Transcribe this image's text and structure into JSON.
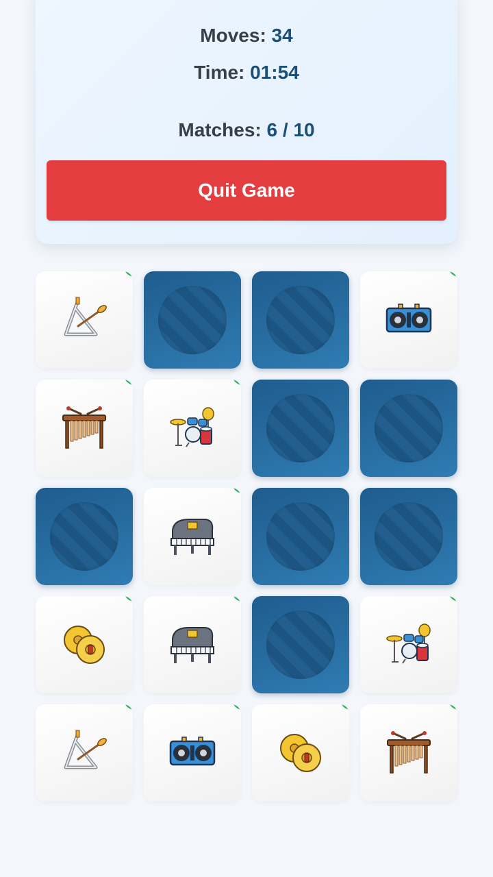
{
  "stats": {
    "moves_label": "Moves:",
    "moves_value": "34",
    "time_label": "Time:",
    "time_value": "01:54",
    "matches_label": "Matches:",
    "matches_value": "6 / 10"
  },
  "quit_label": "Quit Game",
  "colors": {
    "accent": "#1b4f78",
    "quit_button": "#e43d40",
    "card_back": "#2a6fa3",
    "matched_marker": "#2bb35a"
  },
  "cards": [
    {
      "state": "matched",
      "icon": "triangle-icon"
    },
    {
      "state": "hidden"
    },
    {
      "state": "hidden"
    },
    {
      "state": "matched",
      "icon": "dj-controller-icon"
    },
    {
      "state": "matched",
      "icon": "xylophone-icon"
    },
    {
      "state": "matched",
      "icon": "drum-kit-icon"
    },
    {
      "state": "hidden"
    },
    {
      "state": "hidden"
    },
    {
      "state": "hidden"
    },
    {
      "state": "matched",
      "icon": "grand-piano-icon"
    },
    {
      "state": "hidden"
    },
    {
      "state": "hidden"
    },
    {
      "state": "matched",
      "icon": "cymbals-icon"
    },
    {
      "state": "matched",
      "icon": "grand-piano-icon"
    },
    {
      "state": "hidden"
    },
    {
      "state": "matched",
      "icon": "drum-kit-icon"
    },
    {
      "state": "matched",
      "icon": "triangle-icon"
    },
    {
      "state": "matched",
      "icon": "dj-controller-icon"
    },
    {
      "state": "matched",
      "icon": "cymbals-icon"
    },
    {
      "state": "matched",
      "icon": "xylophone-icon"
    }
  ]
}
